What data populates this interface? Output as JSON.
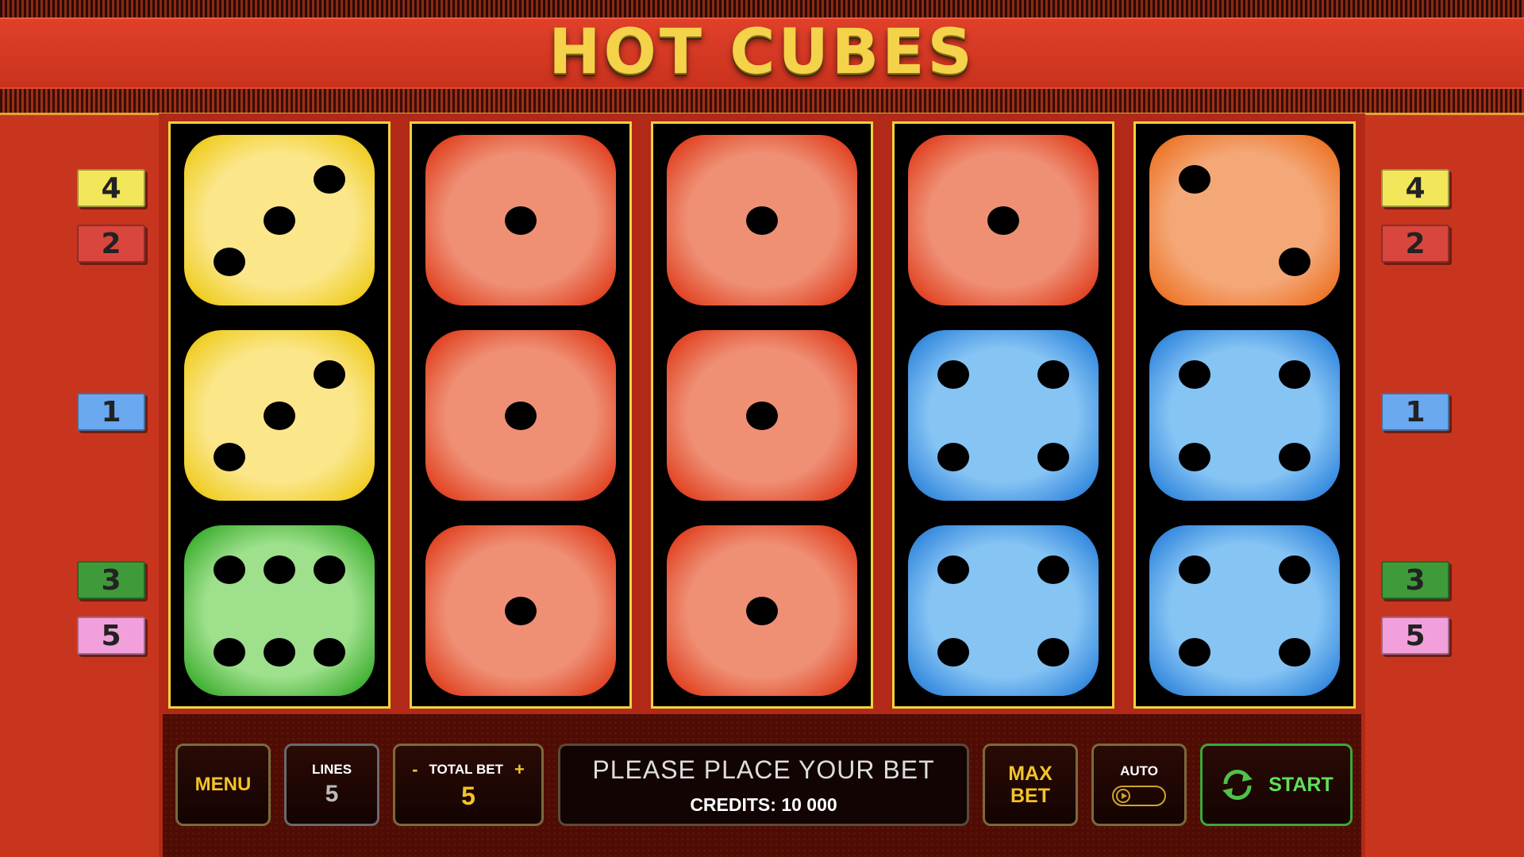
{
  "title": "HOT CUBES",
  "line_badges": {
    "left": [
      "4",
      "2",
      "1",
      "3",
      "5"
    ],
    "right": [
      "4",
      "2",
      "1",
      "3",
      "5"
    ],
    "colors": {
      "4": "#f2e65a",
      "2": "#d8463e",
      "1": "#6aa8f0",
      "3": "#3f9a3a",
      "5": "#f2a0dc"
    }
  },
  "reels": [
    [
      {
        "color": "yellow",
        "face": 3
      },
      {
        "color": "yellow",
        "face": 3
      },
      {
        "color": "green",
        "face": 6
      }
    ],
    [
      {
        "color": "red",
        "face": 1
      },
      {
        "color": "red",
        "face": 1
      },
      {
        "color": "red",
        "face": 1
      }
    ],
    [
      {
        "color": "red",
        "face": 1
      },
      {
        "color": "red",
        "face": 1
      },
      {
        "color": "red",
        "face": 1
      }
    ],
    [
      {
        "color": "red",
        "face": 1
      },
      {
        "color": "blue",
        "face": 4
      },
      {
        "color": "blue",
        "face": 4
      }
    ],
    [
      {
        "color": "orange",
        "face": 2
      },
      {
        "color": "blue",
        "face": 4
      },
      {
        "color": "blue",
        "face": 4
      }
    ]
  ],
  "controls": {
    "menu_label": "MENU",
    "lines_label": "LINES",
    "lines_value": "5",
    "minus_label": "-",
    "total_bet_label": "TOTAL BET",
    "plus_label": "+",
    "total_bet_value": "5",
    "message": "PLEASE PLACE YOUR BET",
    "credits": "CREDITS: 10 000",
    "max_bet_line1": "MAX",
    "max_bet_line2": "BET",
    "auto_label": "AUTO",
    "auto_enabled": false,
    "start_label": "START",
    "start_icon": "refresh-icon"
  }
}
